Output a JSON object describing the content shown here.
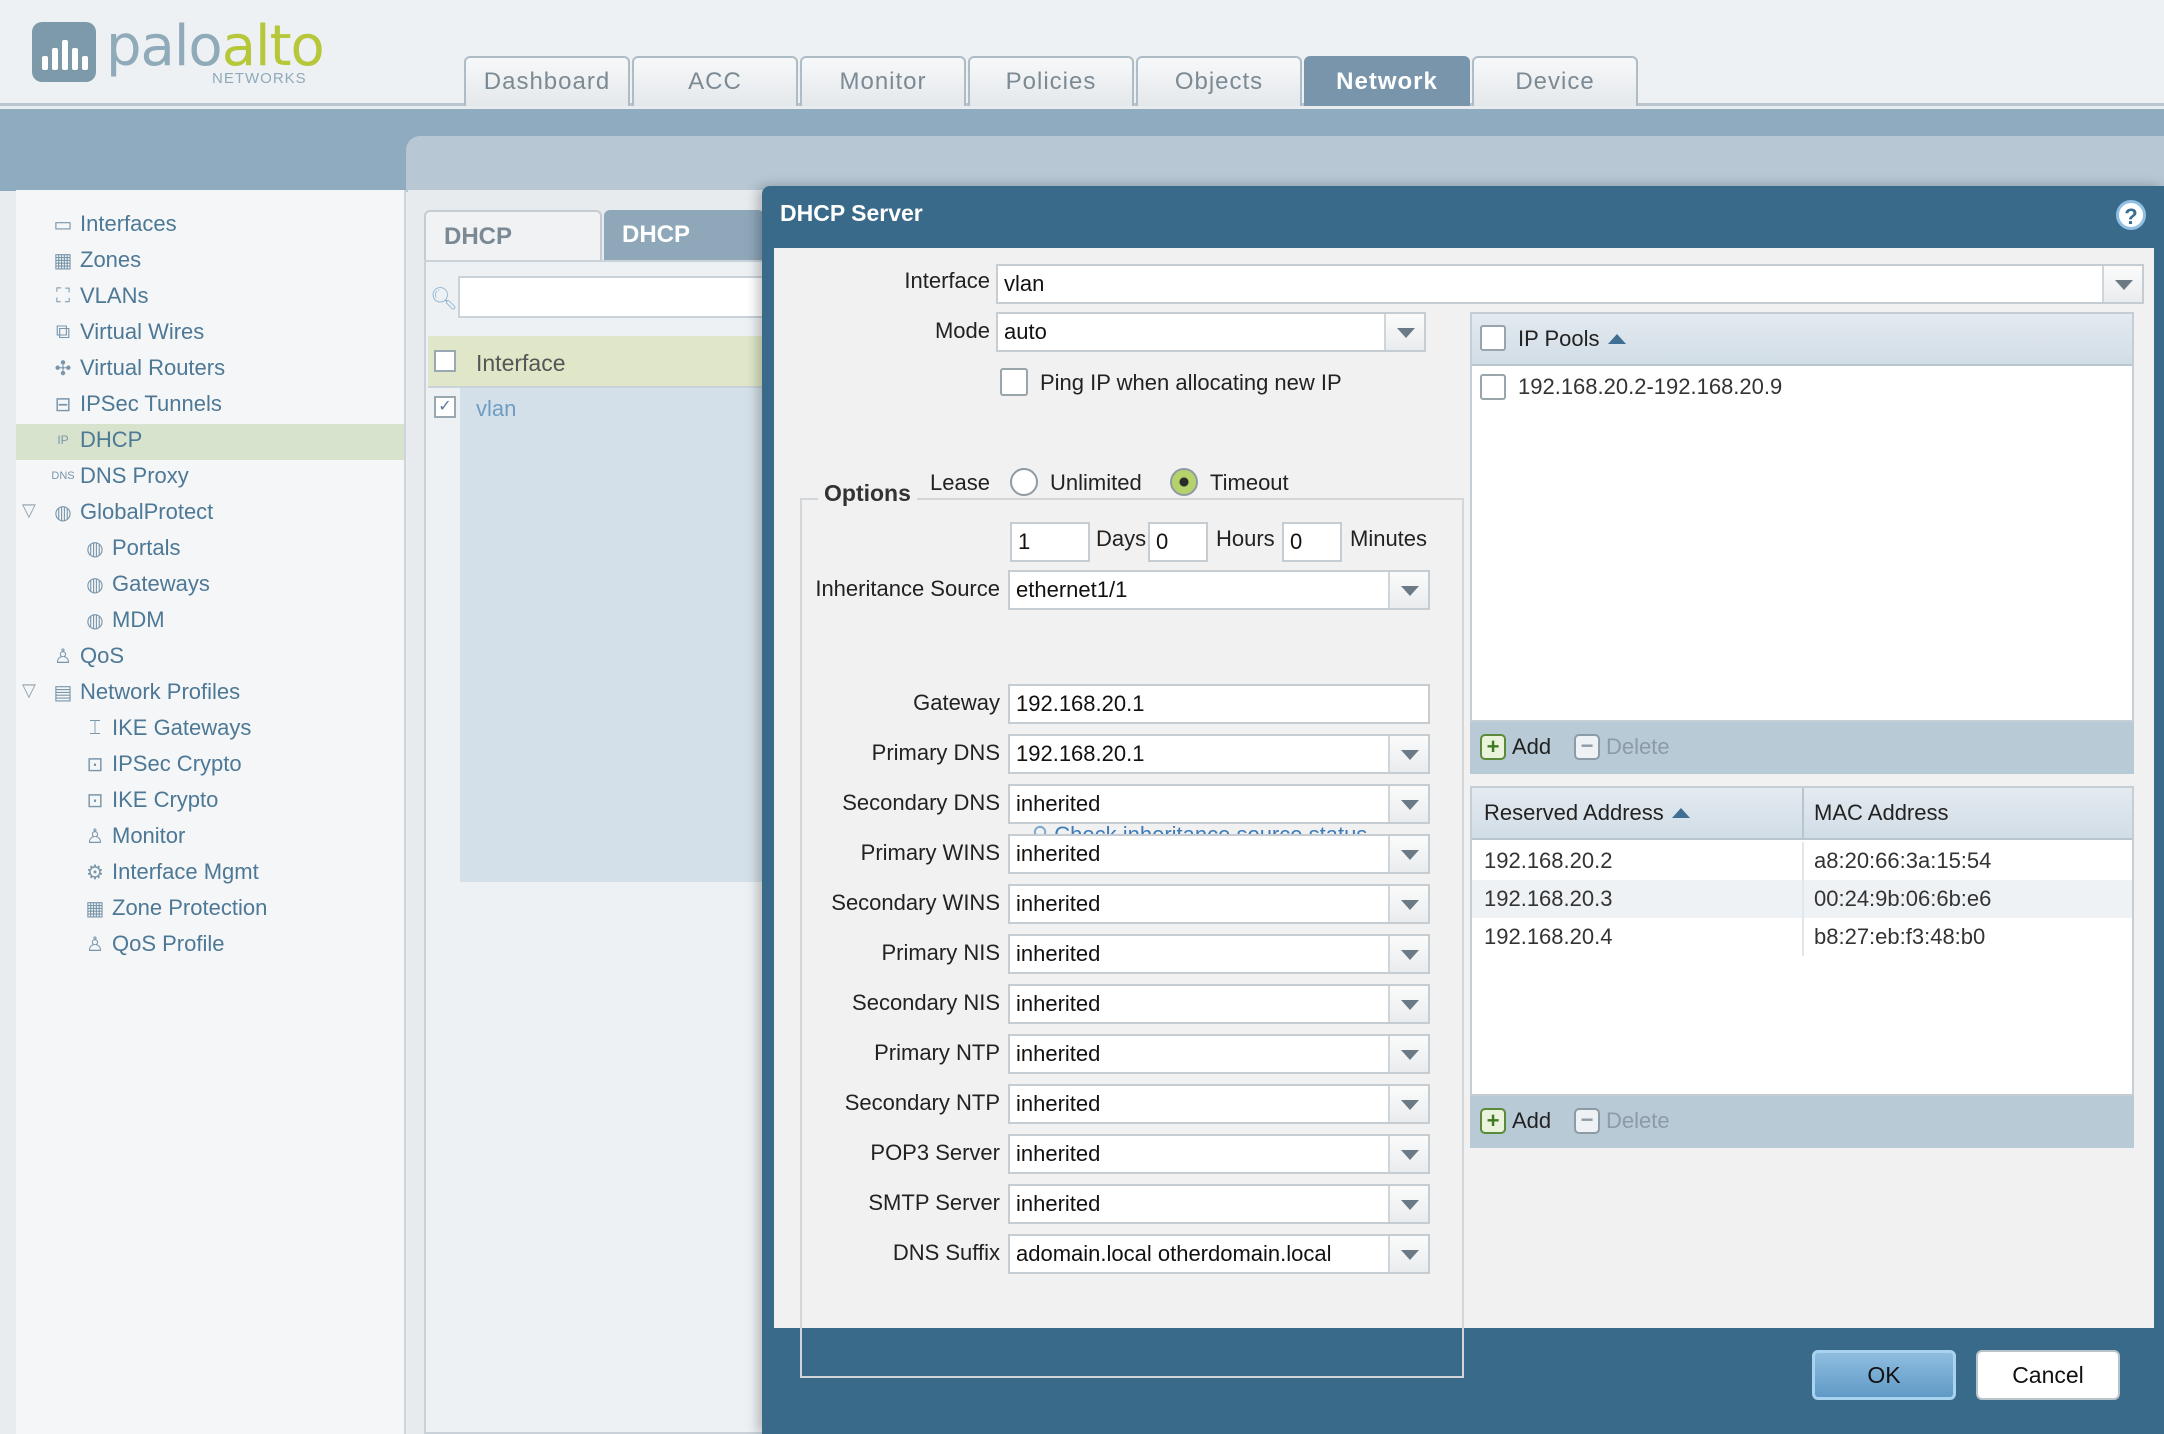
{
  "app": {
    "logo_text_main": "palo",
    "logo_text_accent": "alto",
    "logo_subtext": "NETWORKS",
    "tabs": [
      "Dashboard",
      "ACC",
      "Monitor",
      "Policies",
      "Objects",
      "Network",
      "Device"
    ],
    "active_tab": "Network"
  },
  "sidebar": {
    "items": [
      {
        "label": "Interfaces",
        "icon": "interfaces-icon"
      },
      {
        "label": "Zones",
        "icon": "zones-icon"
      },
      {
        "label": "VLANs",
        "icon": "vlans-icon"
      },
      {
        "label": "Virtual Wires",
        "icon": "virtual-wires-icon"
      },
      {
        "label": "Virtual Routers",
        "icon": "virtual-routers-icon"
      },
      {
        "label": "IPSec Tunnels",
        "icon": "ipsec-tunnels-icon"
      },
      {
        "label": "DHCP",
        "icon": "dhcp-icon",
        "selected": true
      },
      {
        "label": "DNS Proxy",
        "icon": "dns-proxy-icon"
      },
      {
        "label": "GlobalProtect",
        "icon": "globalprotect-icon",
        "expanded": true
      },
      {
        "label": "Portals",
        "icon": "portals-icon"
      },
      {
        "label": "Gateways",
        "icon": "gateways-icon"
      },
      {
        "label": "MDM",
        "icon": "mdm-icon"
      },
      {
        "label": "QoS",
        "icon": "qos-icon"
      },
      {
        "label": "Network Profiles",
        "icon": "network-profiles-icon",
        "expanded": true
      },
      {
        "label": "IKE Gateways",
        "icon": "ike-gateways-icon"
      },
      {
        "label": "IPSec Crypto",
        "icon": "lock-icon"
      },
      {
        "label": "IKE Crypto",
        "icon": "lock-icon"
      },
      {
        "label": "Monitor",
        "icon": "monitor-profile-icon"
      },
      {
        "label": "Interface Mgmt",
        "icon": "interface-mgmt-icon"
      },
      {
        "label": "Zone Protection",
        "icon": "zone-protection-icon"
      },
      {
        "label": "QoS Profile",
        "icon": "qos-profile-icon"
      }
    ]
  },
  "content": {
    "subtabs": [
      "DHCP Server",
      "DHCP Relay"
    ],
    "table_header": "Interface",
    "table_rows": [
      "vlan"
    ]
  },
  "dialog": {
    "title": "DHCP Server",
    "interface": {
      "label": "Interface",
      "value": "vlan"
    },
    "mode": {
      "label": "Mode",
      "value": "auto"
    },
    "ping_ip_label": "Ping IP when allocating new IP",
    "options_legend": "Options",
    "lease": {
      "label": "Lease",
      "unlimited_label": "Unlimited",
      "timeout_label": "Timeout",
      "selected": "Timeout",
      "days": "1",
      "days_label": "Days",
      "hours": "0",
      "hours_label": "Hours",
      "minutes": "0",
      "minutes_label": "Minutes"
    },
    "inheritance_source": {
      "label": "Inheritance Source",
      "value": "ethernet1/1"
    },
    "check_link": "Check inheritance source status",
    "fields": [
      {
        "label": "Gateway",
        "value": "192.168.20.1",
        "dropdown": false
      },
      {
        "label": "Primary DNS",
        "value": "192.168.20.1",
        "dropdown": true
      },
      {
        "label": "Secondary DNS",
        "value": "inherited",
        "dropdown": true
      },
      {
        "label": "Primary WINS",
        "value": "inherited",
        "dropdown": true
      },
      {
        "label": "Secondary WINS",
        "value": "inherited",
        "dropdown": true
      },
      {
        "label": "Primary NIS",
        "value": "inherited",
        "dropdown": true
      },
      {
        "label": "Secondary NIS",
        "value": "inherited",
        "dropdown": true
      },
      {
        "label": "Primary NTP",
        "value": "inherited",
        "dropdown": true
      },
      {
        "label": "Secondary NTP",
        "value": "inherited",
        "dropdown": true
      },
      {
        "label": "POP3 Server",
        "value": "inherited",
        "dropdown": true
      },
      {
        "label": "SMTP Server",
        "value": "inherited",
        "dropdown": true
      },
      {
        "label": "DNS Suffix",
        "value": "adomain.local otherdomain.local",
        "dropdown": true
      }
    ],
    "ip_pools": {
      "header": "IP Pools",
      "rows": [
        "192.168.20.2-192.168.20.9"
      ],
      "add_label": "Add",
      "delete_label": "Delete"
    },
    "reserved": {
      "col_address": "Reserved Address",
      "col_mac": "MAC Address",
      "rows": [
        {
          "address": "192.168.20.2",
          "mac": "a8:20:66:3a:15:54"
        },
        {
          "address": "192.168.20.3",
          "mac": "00:24:9b:06:6b:e6"
        },
        {
          "address": "192.168.20.4",
          "mac": "b8:27:eb:f3:48:b0"
        }
      ],
      "add_label": "Add",
      "delete_label": "Delete"
    },
    "ok_label": "OK",
    "cancel_label": "Cancel"
  },
  "colors": {
    "dialog_header": "#396a8a",
    "active_tab": "#7895ab",
    "nav_link": "#4d7896",
    "selected_nav": "#d7e3cc"
  }
}
